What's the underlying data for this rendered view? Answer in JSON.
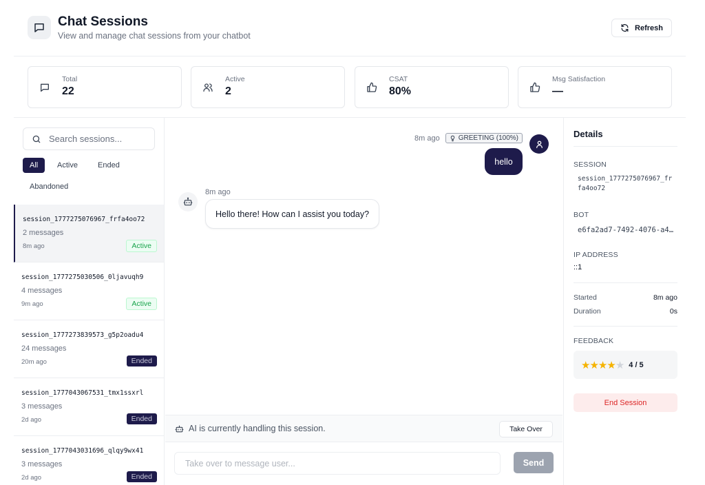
{
  "header": {
    "title": "Chat Sessions",
    "subtitle": "View and manage chat sessions from your chatbot",
    "refresh_label": "Refresh"
  },
  "stats": [
    {
      "label": "Total",
      "value": "22",
      "icon": "chat-icon"
    },
    {
      "label": "Active",
      "value": "2",
      "icon": "users-icon"
    },
    {
      "label": "CSAT",
      "value": "80%",
      "icon": "thumbs-up-icon"
    },
    {
      "label": "Msg Satisfaction",
      "value": "—",
      "icon": "thumbs-up-icon"
    }
  ],
  "sidebar": {
    "search_placeholder": "Search sessions...",
    "filters": [
      "All",
      "Active",
      "Ended",
      "Abandoned"
    ],
    "sessions": [
      {
        "id": "session_1777275076967_frfa4oo72",
        "messages": "2 messages",
        "ago": "8m ago",
        "status": "Active"
      },
      {
        "id": "session_1777275030506_0ljavuqh9",
        "messages": "4 messages",
        "ago": "9m ago",
        "status": "Active"
      },
      {
        "id": "session_1777273839573_g5p2oadu4",
        "messages": "24 messages",
        "ago": "20m ago",
        "status": "Ended"
      },
      {
        "id": "session_1777043067531_tmx1ssxrl",
        "messages": "3 messages",
        "ago": "2d ago",
        "status": "Ended"
      },
      {
        "id": "session_1777043031696_qlqy9wx41",
        "messages": "3 messages",
        "ago": "2d ago",
        "status": "Ended"
      }
    ]
  },
  "chat": {
    "user_message": {
      "time": "8m ago",
      "intent": "GREETING (100%)",
      "text": "hello"
    },
    "bot_message": {
      "time": "8m ago",
      "text": "Hello there! How can I assist you today?"
    },
    "ai_notice": "AI is currently handling this session.",
    "takeover_label": "Take Over",
    "composer_placeholder": "Take over to message user...",
    "send_label": "Send"
  },
  "details": {
    "title": "Details",
    "session_label": "SESSION",
    "session_value_line1": "session_1777275076967_fr",
    "session_value_line2": "fa4oo72",
    "bot_label": "BOT",
    "bot_value": "e6fa2ad7-7492-4076-a4…",
    "ip_label": "IP ADDRESS",
    "ip_value": "::1",
    "started_label": "Started",
    "started_value": "8m ago",
    "duration_label": "Duration",
    "duration_value": "0s",
    "feedback_label": "FEEDBACK",
    "rating": 4,
    "rating_max": 5,
    "rating_text": "4 / 5",
    "end_label": "End Session"
  },
  "colors": {
    "primary": "#1e1b4b",
    "active_badge": "#16a34a",
    "danger": "#dc2626",
    "star": "#f5b301"
  }
}
